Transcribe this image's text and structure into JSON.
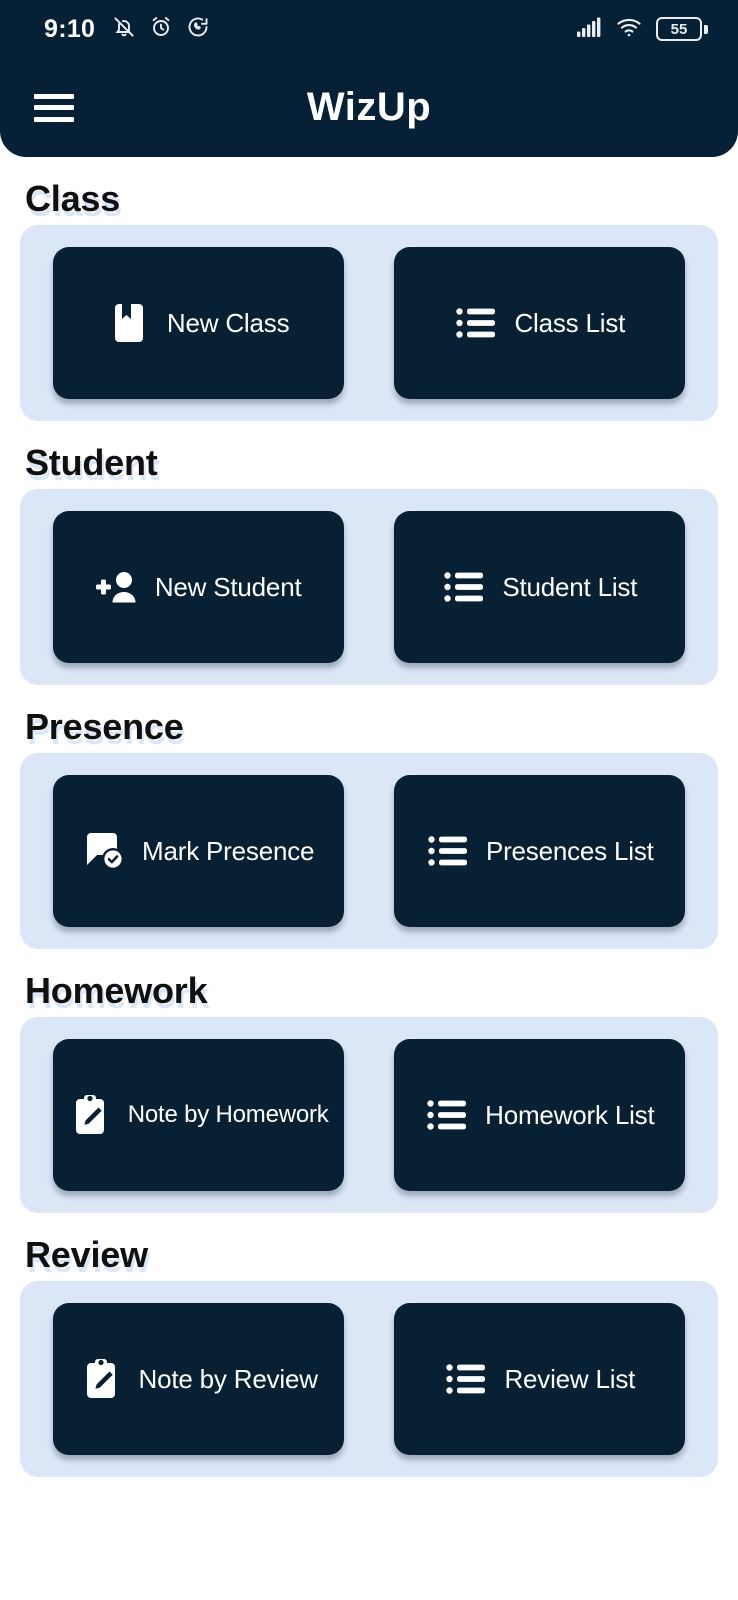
{
  "status_bar": {
    "time": "9:10",
    "icons_left": [
      "bell-off-icon",
      "alarm-clock-icon",
      "whatsapp-icon"
    ],
    "icons_right": [
      "signal-icon",
      "wifi-icon",
      "battery-icon"
    ],
    "battery_level": "55"
  },
  "app_bar": {
    "menu_icon": "hamburger-menu-icon",
    "title": "WizUp"
  },
  "colors": {
    "navy": "#072034",
    "card_blue": "#dbe6f7",
    "white": "#ffffff",
    "heading": "#101010"
  },
  "sections": [
    {
      "title": "Class",
      "tiles": [
        {
          "label": "New Class",
          "icon": "book-bookmark-icon"
        },
        {
          "label": "Class List",
          "icon": "list-icon"
        }
      ]
    },
    {
      "title": "Student",
      "tiles": [
        {
          "label": "New Student",
          "icon": "person-add-icon"
        },
        {
          "label": "Student List",
          "icon": "list-icon"
        }
      ]
    },
    {
      "title": "Presence",
      "tiles": [
        {
          "label": "Mark Presence",
          "icon": "chat-check-icon"
        },
        {
          "label": "Presences List",
          "icon": "list-icon"
        }
      ]
    },
    {
      "title": "Homework",
      "tiles": [
        {
          "label": "Note by Homework",
          "icon": "clipboard-pencil-icon"
        },
        {
          "label": "Homework List",
          "icon": "list-icon"
        }
      ]
    },
    {
      "title": "Review",
      "tiles": [
        {
          "label": "Note by Review",
          "icon": "clipboard-pencil-icon"
        },
        {
          "label": "Review List",
          "icon": "list-icon"
        }
      ]
    }
  ]
}
